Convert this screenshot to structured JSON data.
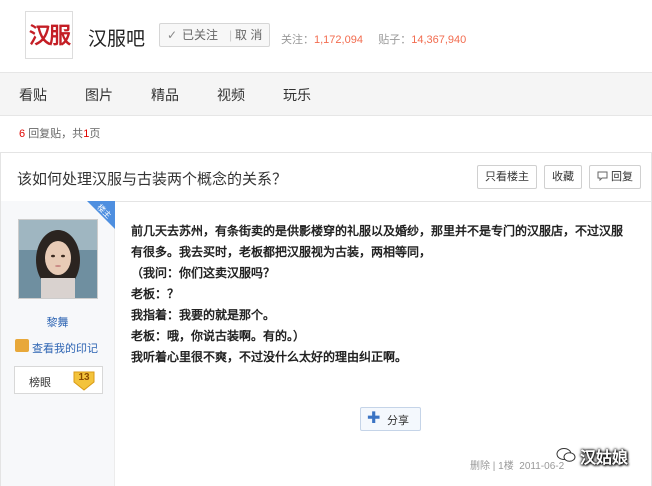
{
  "forum": {
    "logo_text": "汉服",
    "name": "汉服吧",
    "follow_label": "已关注",
    "follow_check": "✓",
    "follow_sep": "|",
    "cancel_label": "取 消",
    "stats_follow_label": "关注：",
    "stats_follow_value": "1,172,094",
    "stats_posts_label": "贴子：",
    "stats_posts_value": "14,367,940"
  },
  "nav": {
    "items": [
      "看贴",
      "图片",
      "精品",
      "视频",
      "玩乐"
    ]
  },
  "thread": {
    "reply_count": "6",
    "reply_label": "回复贴，共",
    "page_count": "1",
    "page_label": "页",
    "title": "该如何处理汉服与古装两个概念的关系？",
    "only_op_label": "只看楼主",
    "collect_label": "收藏",
    "reply_label_btn": "回复"
  },
  "author": {
    "badge_text": "楼主",
    "username": "黎舞",
    "mark_label": "查看我的印记",
    "level_name": "榜眼",
    "level_number": "13"
  },
  "post": {
    "lines": [
      "前几天去苏州，有条街卖的是供影楼穿的礼服以及婚纱，那里并不是专门的汉服店，不过汉服有很多。我去买时，老板都把汉服视为古装，两相等同，",
      "（我问：你们这卖汉服吗？",
      "老板：？",
      "我指着：我要的就是那个。",
      "老板：哦，你说古装啊。有的。）",
      "我听着心里很不爽，不过没什么太好的理由纠正啊。"
    ],
    "share_label": "分享",
    "footer_delete": "删除",
    "footer_sep": "|",
    "footer_floor": "1楼",
    "footer_date": "2011-06-2"
  },
  "watermark": {
    "text": "汉姑娘"
  },
  "colors": {
    "accent_red": "#e10602",
    "link_blue": "#2d64b3",
    "stat_orange": "#f26c4f"
  }
}
